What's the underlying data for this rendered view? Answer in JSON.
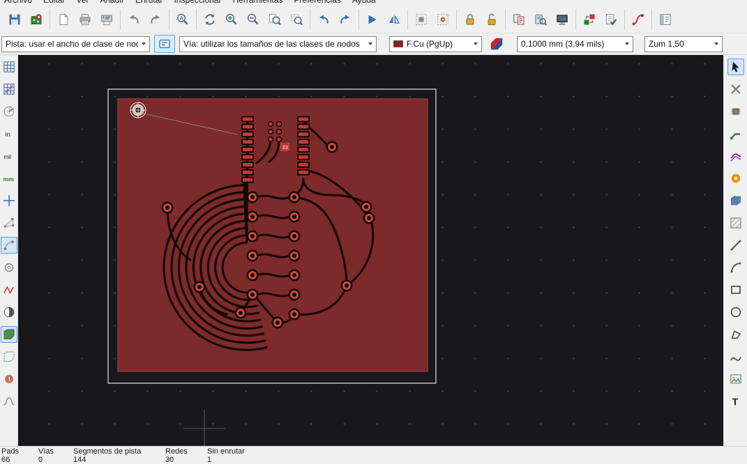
{
  "menu": {
    "items": [
      "Archivo",
      "Editar",
      "Ver",
      "Añadir",
      "Enrutar",
      "Inspeccionar",
      "Herramientas",
      "Preferencias",
      "Ayuda"
    ]
  },
  "top_toolbar": {
    "groups": [
      [
        "save",
        "board-setup"
      ],
      [
        "page-settings",
        "print",
        "plot"
      ],
      [
        "undo",
        "redo"
      ],
      [
        "find"
      ],
      [
        "refresh",
        "zoom-in",
        "zoom-out",
        "zoom-page",
        "zoom-selection"
      ],
      [
        "back",
        "forward"
      ],
      [
        "flip-view",
        "mirror-view"
      ],
      [
        "footprint-mode",
        "pad-mode"
      ],
      [
        "lock",
        "unlock"
      ],
      [
        "netlist",
        "library-browser",
        "layer-manager"
      ],
      [
        "update-pcb",
        "drc"
      ],
      [
        "interactive-router"
      ],
      [
        "panel"
      ]
    ]
  },
  "options_toolbar": {
    "track_width_value": "Pista: usar el ancho de clase de nodo",
    "via_size_value": "Vía: utilizar los tamaños de las clases de nodos",
    "layer_value": "F.Cu (PgUp)",
    "grid_value": "0,1000 mm (3,94 mils)",
    "zoom_value": "Zum 1,50"
  },
  "left_toolbar": {
    "icons": [
      "grid-visibility",
      "grid-axes",
      "polar-coords",
      "units-inch",
      "units-mil",
      "units-mm",
      "cursor-crosshair",
      "ratsnest-visibility",
      "curved-ratsnest",
      "sketch-pads",
      "sketch-tracks",
      "high-contrast",
      "zone-display-filled",
      "zone-display-outline",
      "pad-numbers",
      "microwave-tools"
    ],
    "active": [
      "curved-ratsnest",
      "zone-display-filled"
    ]
  },
  "right_toolbar": {
    "icons": [
      "select-tool",
      "highlight-net",
      "add-footprint",
      "route-tracks",
      "route-diff-pairs",
      "add-via",
      "add-filled-zone",
      "add-rule-area",
      "draw-line",
      "draw-arc",
      "draw-rectangle",
      "draw-circle",
      "draw-polygon",
      "draw-bezier",
      "add-image",
      "add-text"
    ],
    "active": [
      "select-tool"
    ]
  },
  "canvas": {
    "component_ref": "23"
  },
  "status_bar": {
    "items": [
      {
        "label": "Pads",
        "value": "66"
      },
      {
        "label": "Vías",
        "value": "0"
      },
      {
        "label": "Segmentos de pista",
        "value": "144"
      },
      {
        "label": "Redes",
        "value": "30"
      },
      {
        "label": "Sin enrutar",
        "value": "1"
      }
    ]
  }
}
